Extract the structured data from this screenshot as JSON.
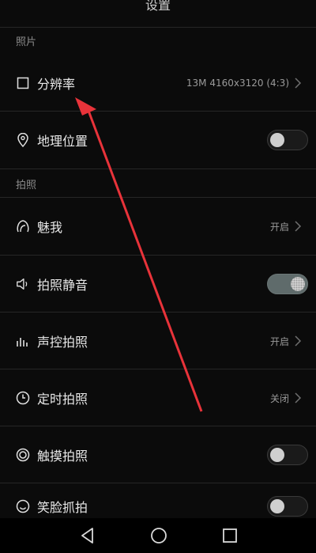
{
  "header": {
    "title": "设置"
  },
  "sections": {
    "photo": {
      "label": "照片"
    },
    "shoot": {
      "label": "拍照"
    }
  },
  "rows": {
    "resolution": {
      "label": "分辨率",
      "value": "13M 4160x3120 (4:3)"
    },
    "location": {
      "label": "地理位置",
      "toggle": false
    },
    "beauty": {
      "label": "魅我",
      "value": "开启"
    },
    "mute": {
      "label": "拍照静音",
      "toggle": true
    },
    "voice": {
      "label": "声控拍照",
      "value": "开启"
    },
    "timer": {
      "label": "定时拍照",
      "value": "关闭"
    },
    "touch": {
      "label": "触摸拍照",
      "toggle": false
    },
    "smile": {
      "label": "笑脸抓拍",
      "toggle": false
    }
  },
  "colors": {
    "background": "#0b0b0b",
    "annotation_arrow": "#e8333a"
  },
  "icons": [
    "square-icon",
    "location-pin-icon",
    "beauty-icon",
    "speaker-icon",
    "voice-bars-icon",
    "timer-icon",
    "touch-shutter-icon",
    "smile-icon",
    "chevron-right-icon",
    "back-icon",
    "home-icon",
    "recents-icon"
  ]
}
